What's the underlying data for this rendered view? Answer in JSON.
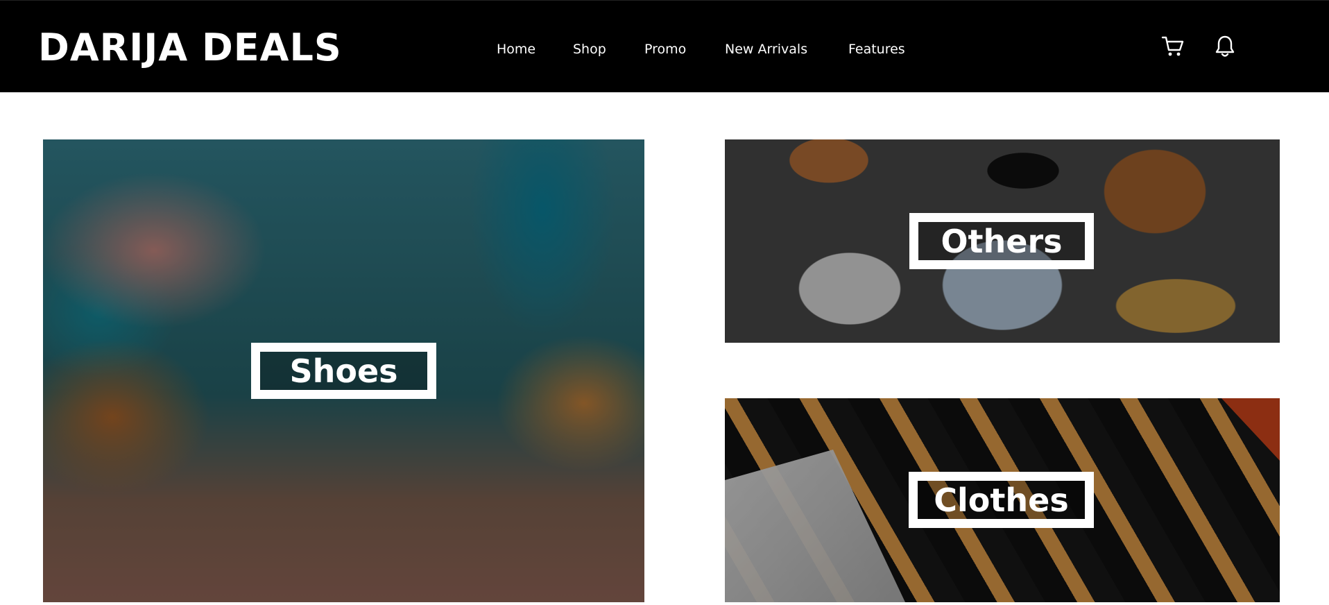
{
  "header": {
    "brand": "DARIJA DEALS",
    "nav": [
      {
        "label": "Home"
      },
      {
        "label": "Shop"
      },
      {
        "label": "Promo"
      },
      {
        "label": "New Arrivals"
      },
      {
        "label": "Features"
      }
    ],
    "icons": [
      "cart-icon",
      "bell-icon"
    ]
  },
  "categories": [
    {
      "label": "Shoes"
    },
    {
      "label": "Others"
    },
    {
      "label": "Clothes"
    }
  ],
  "colors": {
    "navbar_bg": "#000000",
    "text_on_dark": "#ffffff",
    "page_bg": "#ffffff"
  }
}
